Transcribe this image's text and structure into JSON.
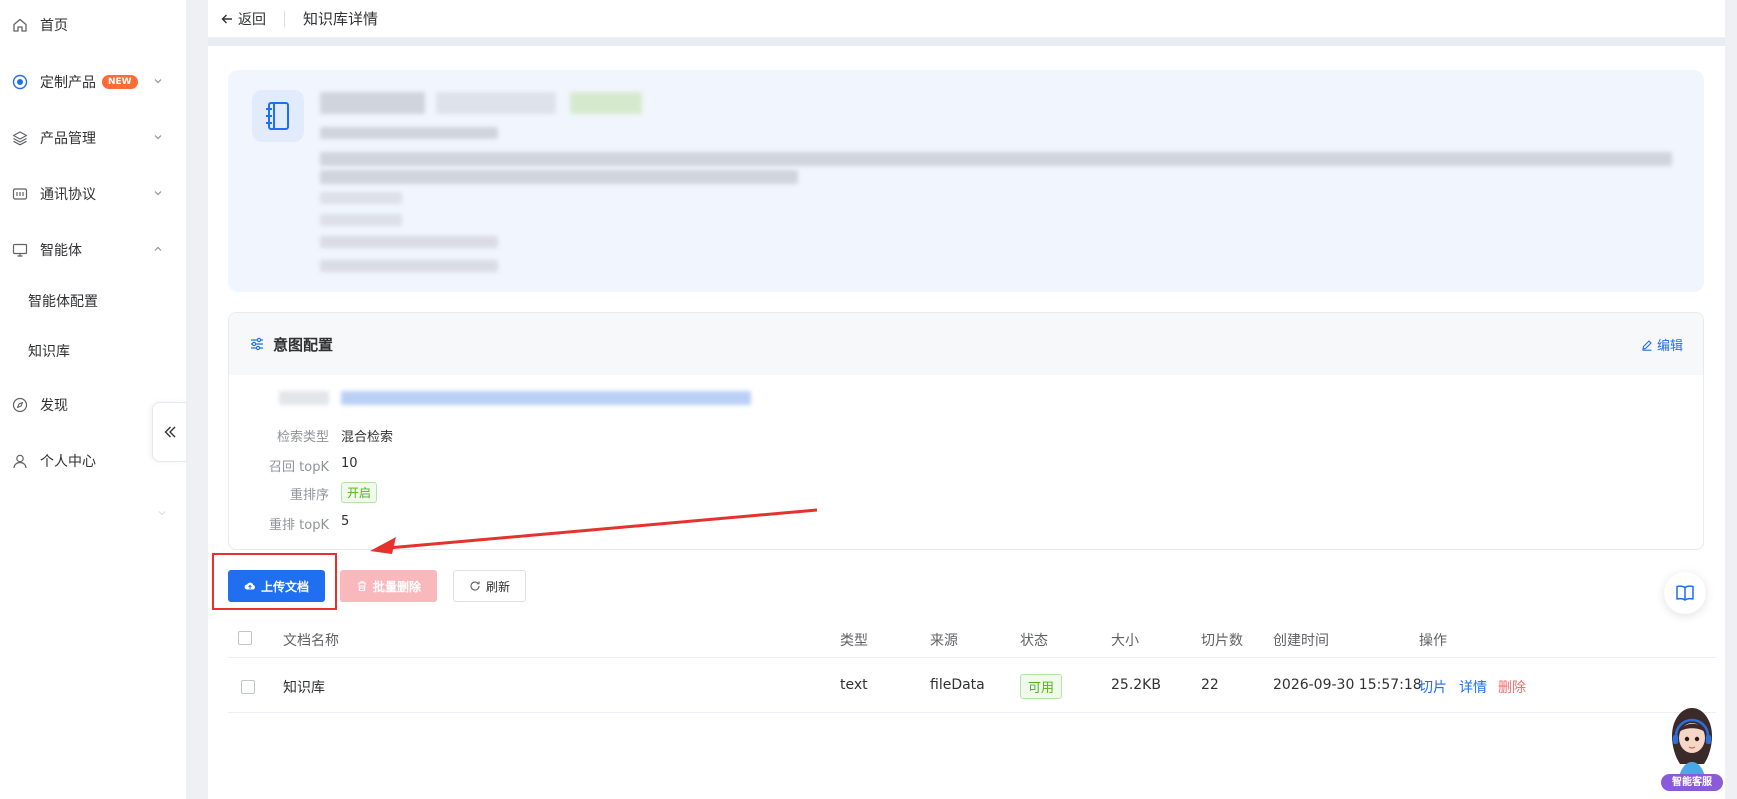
{
  "sidebar": {
    "items": [
      {
        "label": "首页",
        "icon": "home-icon"
      },
      {
        "label": "定制产品",
        "icon": "custom-product-icon",
        "badge": "NEW"
      },
      {
        "label": "产品管理",
        "icon": "layers-icon"
      },
      {
        "label": "通讯协议",
        "icon": "protocol-icon"
      },
      {
        "label": "智能体",
        "icon": "monitor-icon"
      },
      {
        "label": "发现",
        "icon": "compass-icon"
      },
      {
        "label": "个人中心",
        "icon": "user-icon"
      }
    ],
    "sub_items": [
      {
        "label": "智能体配置"
      },
      {
        "label": "知识库"
      }
    ]
  },
  "header": {
    "back_label": "返回",
    "title": "知识库详情"
  },
  "intent": {
    "title": "意图配置",
    "edit_label": "编辑",
    "fields": [
      {
        "label": "检索类型",
        "value": "混合检索"
      },
      {
        "label": "召回 topK",
        "value": "10"
      },
      {
        "label": "重排序",
        "value": "开启"
      },
      {
        "label": "重排 topK",
        "value": "5"
      }
    ]
  },
  "toolbar": {
    "upload_label": "上传文档",
    "batch_delete_label": "批量删除",
    "refresh_label": "刷新"
  },
  "table": {
    "columns": [
      "文档名称",
      "类型",
      "来源",
      "状态",
      "大小",
      "切片数",
      "创建时间",
      "操作"
    ],
    "rows": [
      {
        "name": "知识库",
        "type": "text",
        "source": "fileData",
        "status": "可用",
        "size": "25.2KB",
        "chunks": "22",
        "created": "2026-09-30 15:57:18",
        "actions": [
          "切片",
          "详情",
          "删除"
        ]
      }
    ]
  },
  "assistant": {
    "label": "智能客服"
  },
  "colors": {
    "primary": "#1f6ff0",
    "danger": "#f56c6c",
    "success": "#52b520",
    "highlight": "#e5322d"
  }
}
